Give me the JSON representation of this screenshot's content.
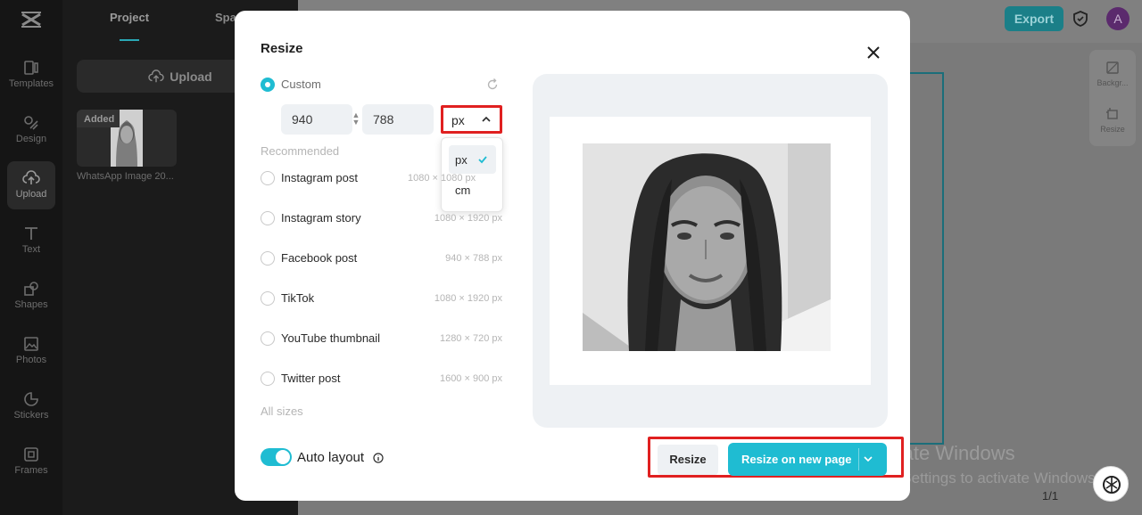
{
  "app": {
    "left_rail": [
      {
        "label": "Templates",
        "icon": "templates-icon"
      },
      {
        "label": "Design",
        "icon": "design-icon"
      },
      {
        "label": "Upload",
        "icon": "upload-icon",
        "active": true
      },
      {
        "label": "Text",
        "icon": "text-icon"
      },
      {
        "label": "Shapes",
        "icon": "shapes-icon"
      },
      {
        "label": "Photos",
        "icon": "photos-icon"
      },
      {
        "label": "Stickers",
        "icon": "stickers-icon"
      },
      {
        "label": "Frames",
        "icon": "frames-icon"
      }
    ],
    "panel": {
      "tabs": [
        "Project",
        "Spa"
      ],
      "upload_label": "Upload",
      "thumb_badge": "Added",
      "thumb_name": "WhatsApp Image 20..."
    },
    "topbar": {
      "export_label": "Export",
      "avatar_letter": "A"
    },
    "right_tools": [
      {
        "label": "Backgr...",
        "icon": "background-icon"
      },
      {
        "label": "Resize",
        "icon": "resize-icon"
      }
    ],
    "pager": "1/1",
    "watermark": {
      "line1": "Activate Windows",
      "line2": "Go to Settings to activate Windows."
    }
  },
  "modal": {
    "title": "Resize",
    "custom_label": "Custom",
    "width_value": "940",
    "height_value": "788",
    "unit_selected": "px",
    "unit_options": [
      "px",
      "cm"
    ],
    "recommended_label": "Recommended",
    "presets": [
      {
        "name": "Instagram post",
        "dims": "1080 × 1080 px"
      },
      {
        "name": "Instagram story",
        "dims": "1080 × 1920 px"
      },
      {
        "name": "Facebook post",
        "dims": "940 × 788 px"
      },
      {
        "name": "TikTok",
        "dims": "1080 × 1920 px"
      },
      {
        "name": "YouTube thumbnail",
        "dims": "1280 × 720 px"
      },
      {
        "name": "Twitter post",
        "dims": "1600 × 900 px"
      }
    ],
    "all_sizes_label": "All sizes",
    "auto_layout_label": "Auto layout",
    "auto_layout_on": true,
    "resize_button": "Resize",
    "resize_new_page_button": "Resize on new page"
  },
  "colors": {
    "accent": "#1fbcd2",
    "highlight": "#e02020",
    "export": "#1b7f88"
  }
}
